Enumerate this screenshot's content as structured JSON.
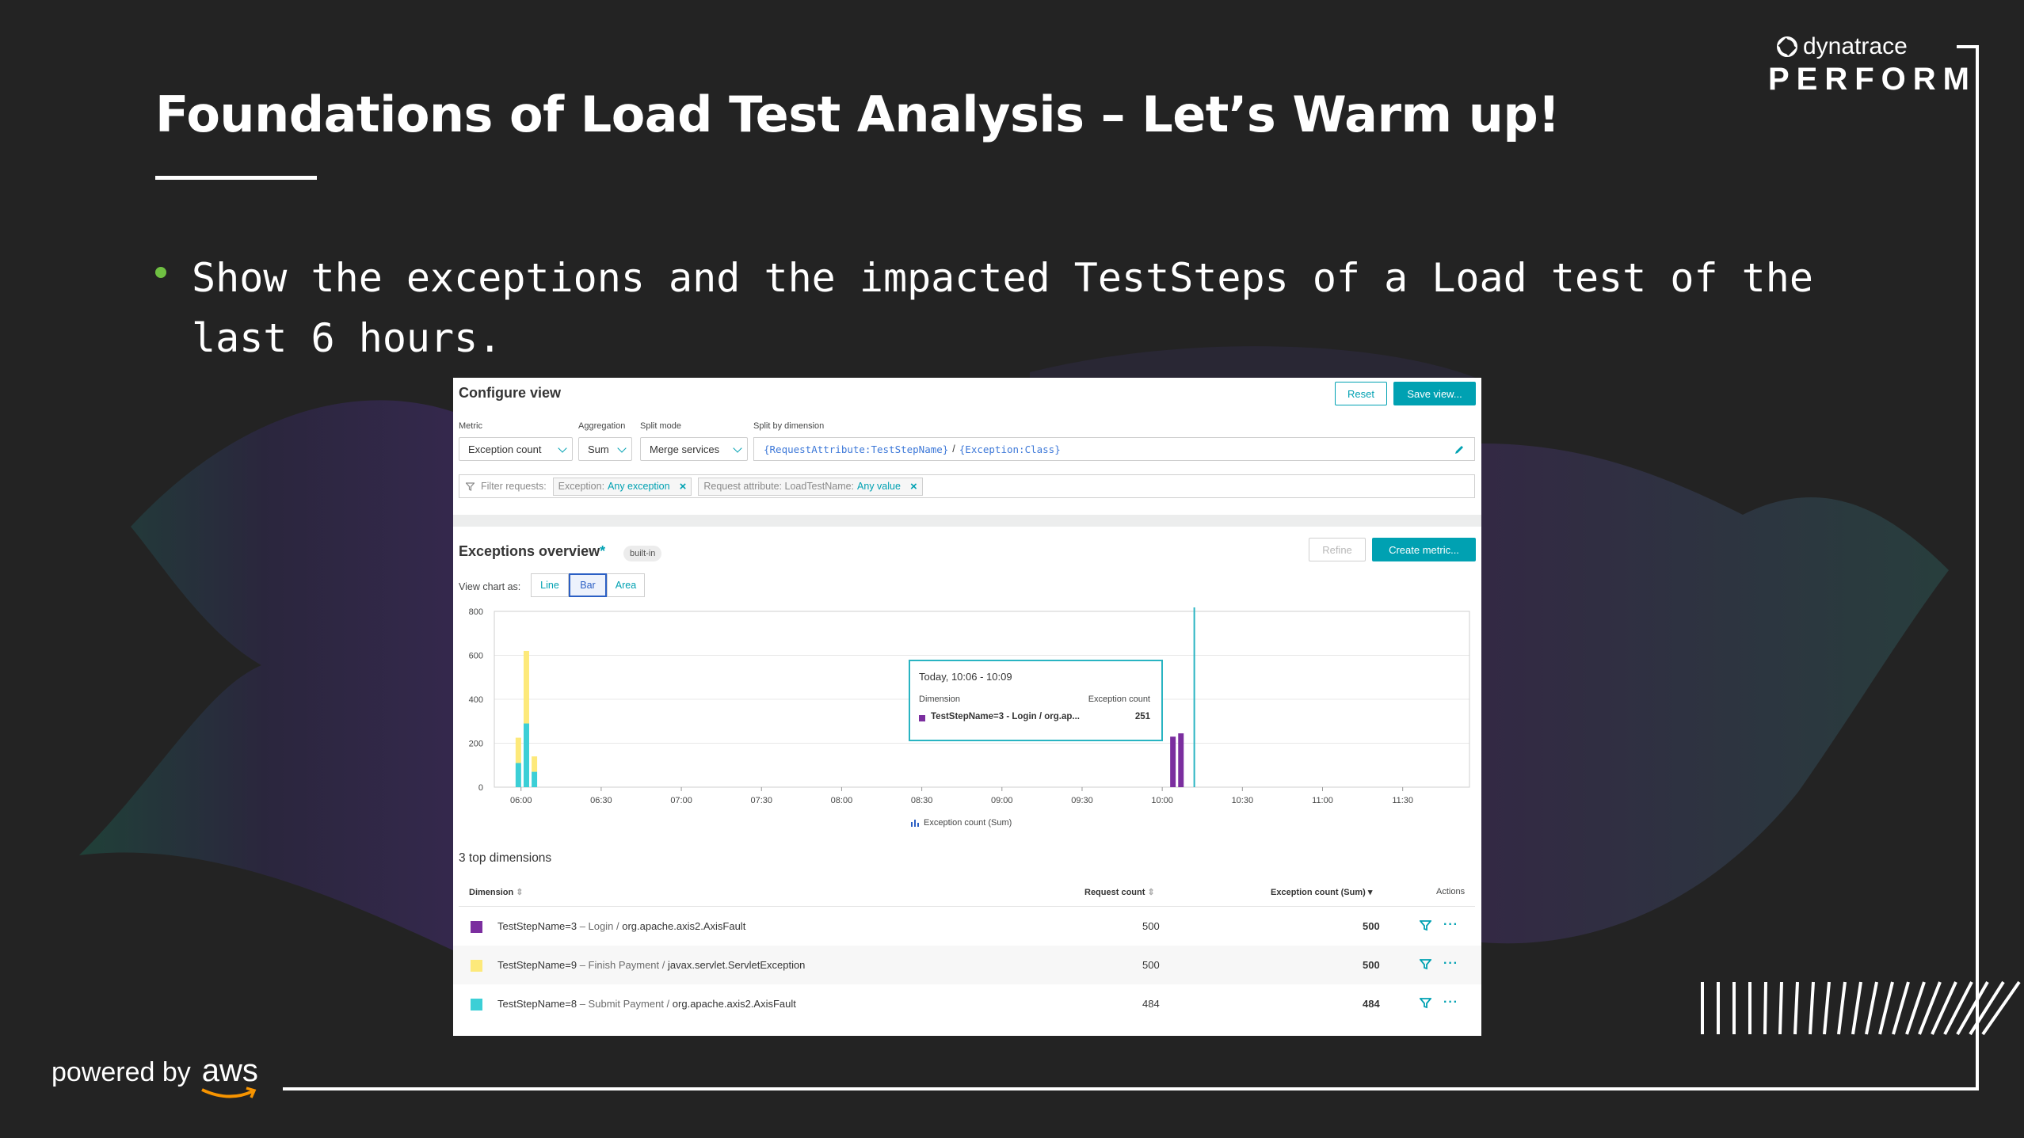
{
  "slide": {
    "title": "Foundations of Load Test Analysis – Let’s Warm up!",
    "bullet": "Show the exceptions and the impacted TestSteps of a Load test of the last 6 hours.",
    "logo_brand": "dynatrace",
    "logo_event": "PERFORM",
    "powered_by": "powered by",
    "aws": "aws",
    "colors": {
      "background": "#232323",
      "bullet": "#6fc042",
      "accent": "#00a1b2"
    }
  },
  "configure_view": {
    "title": "Configure view",
    "reset_label": "Reset",
    "save_label": "Save view...",
    "metric_label": "Metric",
    "metric_value": "Exception count",
    "aggregation_label": "Aggregation",
    "aggregation_value": "Sum",
    "split_mode_label": "Split mode",
    "split_mode_value": "Merge services",
    "split_dimension_label": "Split by dimension",
    "dimension_part1": "{RequestAttribute:TestStepName}",
    "dimension_sep": "/",
    "dimension_part2": "{Exception:Class}",
    "filter_label": "Filter requests:",
    "filters": [
      {
        "key": "Exception:",
        "value": "Any exception"
      },
      {
        "key": "Request attribute: LoadTestName:",
        "value": "Any value"
      }
    ]
  },
  "overview": {
    "title": "Exceptions overview",
    "star": "*",
    "badge": "built-in",
    "refine_label": "Refine",
    "create_metric_label": "Create metric...",
    "view_chart_as": "View chart as:",
    "chart_types": [
      "Line",
      "Bar",
      "Area"
    ],
    "active_chart_type": "Bar"
  },
  "chart_data": {
    "type": "bar",
    "stacked": true,
    "y_ticks": [
      "800",
      "600",
      "400",
      "200",
      "0"
    ],
    "ylim": [
      0,
      800
    ],
    "x_ticks": [
      "06:00",
      "06:30",
      "07:00",
      "07:30",
      "08:00",
      "08:30",
      "09:00",
      "09:30",
      "10:00",
      "10:30",
      "11:00",
      "11:30"
    ],
    "x_range_minutes": [
      -10,
      355
    ],
    "legend_label": "Exception count (Sum)",
    "series": [
      {
        "name": "TestStepName=3 – Login / org.apache.axis2.AxisFault",
        "color": "#7b2e9f"
      },
      {
        "name": "TestStepName=9 – Finish Payment / javax.servlet.ServletException",
        "color": "#fde97a"
      },
      {
        "name": "TestStepName=8 – Submit Payment / org.apache.axis2.AxisFault",
        "color": "#3ccfd6"
      }
    ],
    "bars": [
      {
        "t": -1,
        "segments": [
          {
            "series": 2,
            "value": 110
          },
          {
            "series": 1,
            "value": 115
          }
        ]
      },
      {
        "t": 2,
        "segments": [
          {
            "series": 2,
            "value": 290
          },
          {
            "series": 1,
            "value": 330
          }
        ]
      },
      {
        "t": 5,
        "segments": [
          {
            "series": 2,
            "value": 70
          },
          {
            "series": 1,
            "value": 70
          }
        ]
      },
      {
        "t": 244,
        "segments": [
          {
            "series": 0,
            "value": 230
          }
        ]
      },
      {
        "t": 247,
        "segments": [
          {
            "series": 0,
            "value": 245
          }
        ]
      }
    ],
    "hover_line_t": 252,
    "tooltip": {
      "time": "Today, 10:06 - 10:09",
      "col1": "Dimension",
      "col2": "Exception count",
      "row_name": "TestStepName=3 - Login / org.ap...",
      "row_value": "251"
    }
  },
  "top_dimensions": {
    "title": "3 top dimensions",
    "headers": {
      "dimension": "Dimension",
      "request_count": "Request count",
      "exception_count": "Exception count (Sum)",
      "actions": "Actions"
    },
    "rows": [
      {
        "color": "#7b2e9f",
        "name": "TestStepName=3",
        "step": "– Login /",
        "exception": "org.apache.axis2.AxisFault",
        "requests": "500",
        "exceptions": "500"
      },
      {
        "color": "#fde97a",
        "name": "TestStepName=9",
        "step": "– Finish Payment /",
        "exception": "javax.servlet.ServletException",
        "requests": "500",
        "exceptions": "500"
      },
      {
        "color": "#3ccfd6",
        "name": "TestStepName=8",
        "step": "– Submit Payment /",
        "exception": "org.apache.axis2.AxisFault",
        "requests": "484",
        "exceptions": "484"
      }
    ]
  }
}
